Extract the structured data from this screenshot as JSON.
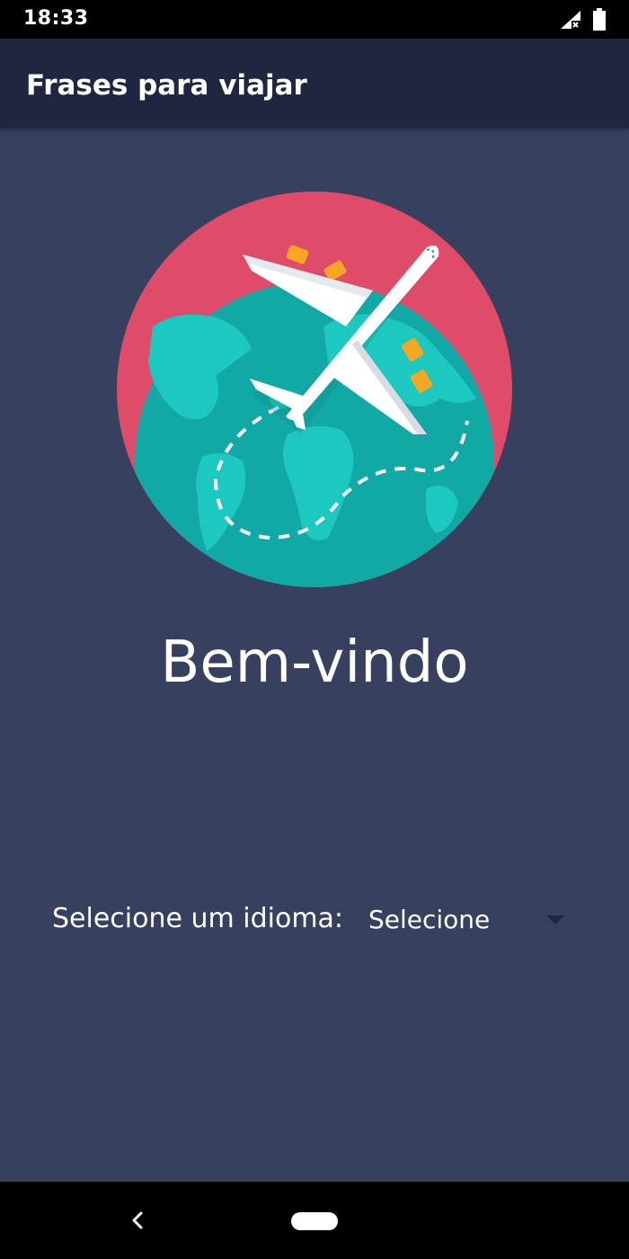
{
  "status_bar": {
    "time": "18:33",
    "icons": [
      "signal-no-service-icon",
      "battery-icon"
    ]
  },
  "app_bar": {
    "title": "Frases para viajar"
  },
  "hero": {
    "icon": "airplane-over-globe-icon",
    "colors": {
      "circle": "#df4c69",
      "globe": "#12a8a5",
      "land": "#1cc8bf",
      "plane": "#ffffff",
      "engine": "#f5a623"
    }
  },
  "welcome": {
    "text": "Bem-vindo"
  },
  "language": {
    "label": "Selecione um idioma:",
    "selected": "Selecione"
  },
  "nav_bar": {
    "icons": [
      "back-icon",
      "home-icon"
    ]
  },
  "colors": {
    "background": "#37415f",
    "app_bar": "#1e2640",
    "system_bars": "#000000"
  }
}
